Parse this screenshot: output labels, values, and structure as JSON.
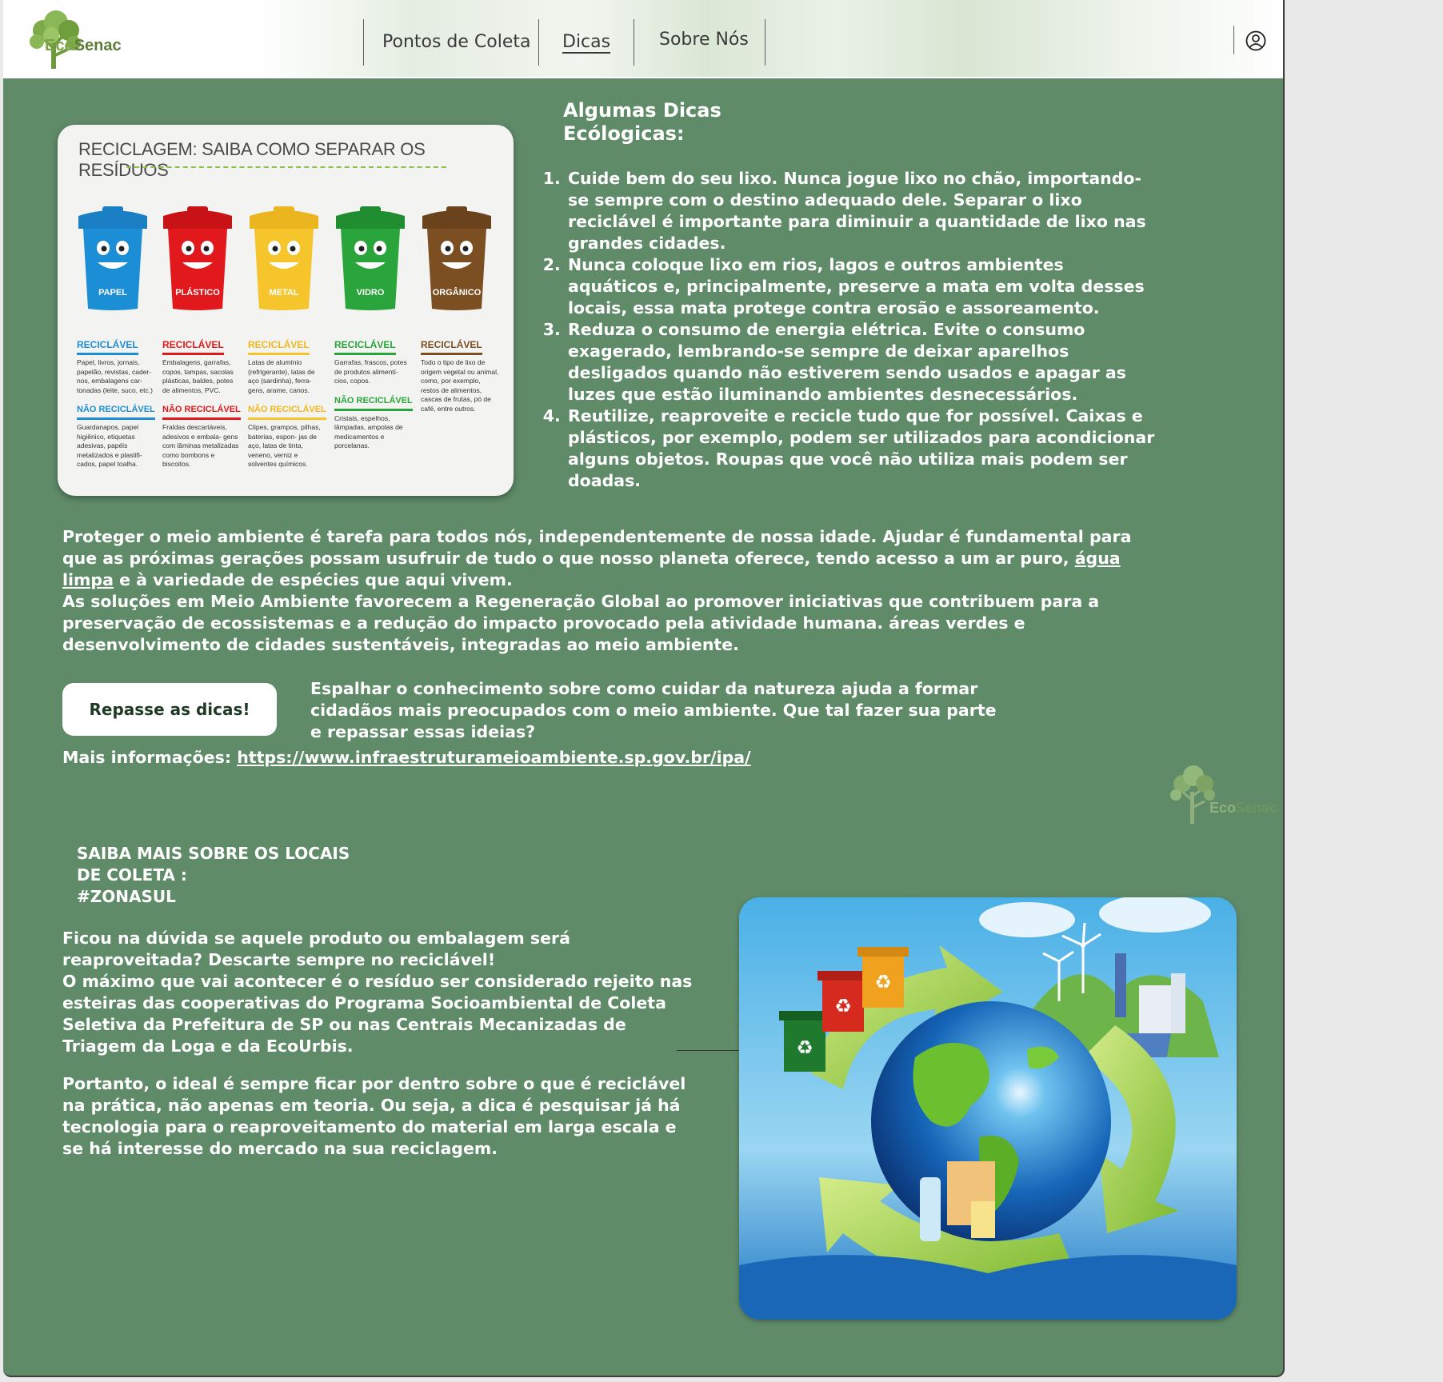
{
  "header": {
    "logo": {
      "eco": "Eco",
      "senac": "Senac"
    },
    "nav": [
      {
        "label": "Pontos de Coleta"
      },
      {
        "label": "Dicas"
      },
      {
        "label": "Sobre Nós"
      }
    ],
    "user_icon": "user-circle-icon"
  },
  "colors": {
    "page_bg": "#5f8b69",
    "text": "#ffffff",
    "logo_green": "#7aa447",
    "bin_blue": "#1c8ed6",
    "bin_red": "#e2191c",
    "bin_yellow": "#f6c52c",
    "bin_green": "#29a53b",
    "bin_brown": "#7b4f22"
  },
  "recycling_card": {
    "title": "RECICLAGEM: SAIBA COMO SEPARAR OS RESÍDUOS",
    "bins": [
      {
        "label": "PAPEL",
        "color": "#1c8ed6",
        "recyclable_title": "RECICLÁVEL",
        "recyclable": "Papel, livros, jornais, papelão, revistas, cader- nos, embalagens car- tonadas (leite, suco, etc.)",
        "non_recyclable_title": "NÃO RECICLÁVEL",
        "non_recyclable": "Guardanapos, papel higiênico, etiquetas adesivas, papéis metalizados e plastifi- cados, papel toalha."
      },
      {
        "label": "PLÁSTICO",
        "color": "#e2191c",
        "recyclable_title": "RECICLÁVEL",
        "recyclable": "Embalagens, garrafas, copos, tampas, sacolas plásticas, baldes, potes de alimentos, PVC.",
        "non_recyclable_title": "NÃO RECICLÁVEL",
        "non_recyclable": "Fraldas descartáveis, adesivos e embala- gens com lâminas metalizadas como bombons e biscoitos."
      },
      {
        "label": "METAL",
        "color": "#f6c52c",
        "recyclable_title": "RECICLÁVEL",
        "recyclable": "Latas de alumínio (refrigerante), latas de aço (sardinha), ferra- gens, arame, canos.",
        "non_recyclable_title": "NÃO RECICLÁVEL",
        "non_recyclable": "Clipes, grampos, pilhas, baterias, espon- jas de aço, latas de tinta, veneno, verniz e solventes químicos."
      },
      {
        "label": "VIDRO",
        "color": "#29a53b",
        "recyclable_title": "RECICLÁVEL",
        "recyclable": "Garrafas, frascos, potes de produtos alimentí- cios, copos.",
        "non_recyclable_title": "NÃO RECICLÁVEL",
        "non_recyclable": "Cristais, espelhos, lâmpadas, ampolas de medicamentos e porcelanas."
      },
      {
        "label": "ORGÂNICO",
        "color": "#7b4f22",
        "recyclable_title": "RECICLÁVEL",
        "recyclable": "Todo o tipo de lixo de origem vegetal ou animal, como, por exemplo, restos de alimentos, cascas de frutas, pó de café, entre outros.",
        "non_recyclable_title": "",
        "non_recyclable": ""
      }
    ]
  },
  "tips": {
    "title_line1": "Algumas Dicas",
    "title_line2": "Ecólogicas:",
    "items": [
      "Cuide bem do seu lixo. Nunca jogue lixo no chão, importando-se sempre com o destino adequado dele. Separar o lixo reciclável é importante para diminuir a quantidade de lixo nas grandes cidades.",
      "Nunca coloque lixo em rios, lagos e outros ambientes aquáticos e, principalmente, preserve a mata em volta desses locais, essa mata protege contra erosão e assoreamento.",
      "Reduza o consumo de energia elétrica. Evite o consumo exagerado, lembrando-se sempre de deixar aparelhos desligados quando não estiverem sendo usados e apagar as luzes que estão iluminando ambientes desnecessários.",
      "Reutilize, reaproveite e recicle tudo que for possível. Caixas e plásticos, por exemplo, podem ser utilizados para acondicionar alguns objetos. Roupas que você não utiliza mais podem ser doadas."
    ]
  },
  "intro": {
    "p1_before": "Proteger o meio ambiente é tarefa para todos nós, independentemente de nossa idade. Ajudar é fundamental para que as próximas gerações possam usufruir de tudo o que nosso planeta oferece, tendo acesso a um ar puro, ",
    "p1_link": "água limpa",
    "p1_after": " e à variedade de espécies que aqui vivem.",
    "p2": "As soluções em Meio Ambiente favorecem a Regeneração Global ao promover iniciativas que contribuem para a preservação de ecossistemas e a redução do impacto provocado pela atividade humana. áreas verdes e desenvolvimento de cidades sustentáveis, integradas ao meio ambiente."
  },
  "share": {
    "button": "Repasse as dicas!",
    "text": "Espalhar o conhecimento sobre como cuidar da natureza ajuda a formar cidadãos mais preocupados com o meio ambiente. Que tal fazer sua parte e repassar essas ideias?",
    "more_label": "Mais informações: ",
    "more_link": "https://www.infraestruturameioambiente.sp.gov.br/ipa/"
  },
  "coleta": {
    "line1": "SAIBA MAIS SOBRE OS LOCAIS",
    "line2": "DE COLETA :",
    "line3": "#ZONASUL",
    "p1": "Ficou na dúvida se aquele produto ou embalagem será reaproveitada? Descarte sempre no reciclável!",
    "p2": "O máximo que vai acontecer é o resíduo ser considerado rejeito nas esteiras das cooperativas do Programa Socioambiental de Coleta Seletiva da Prefeitura de SP ou nas Centrais Mecanizadas de Triagem da Loga e da EcoUrbis.",
    "p3": "Portanto, o ideal é sempre ficar por dentro sobre o que é reciclável na prática, não apenas em teoria. Ou seja, a dica é pesquisar já há tecnologia para o reaproveitamento do material em larga escala e se há interesse do mercado na sua reciclagem."
  }
}
